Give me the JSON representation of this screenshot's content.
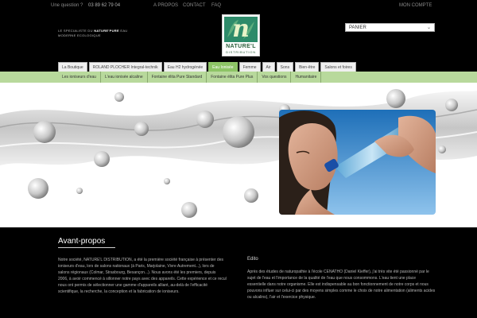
{
  "topbar": {
    "question": "Une question ?",
    "phone": "03 89 62 79 04",
    "links": [
      "A PROPOS",
      "CONTACT",
      "FAQ"
    ],
    "account": "MON COMPTE"
  },
  "header": {
    "tagline_line1_prefix": "LE SPECIALISTE DU",
    "tagline_brand": "NATURE'PURE",
    "tagline_line1_suffix": "EAU",
    "tagline_line2": "MODERNE ECOLOGIQUE",
    "logo_word": "NATURE'L",
    "logo_sub": "DISTRIBUTION",
    "logo_letter": "n",
    "cart_label": "PANIER"
  },
  "nav": {
    "main": [
      "La Boutique",
      "ROLAND PLOCHER Integral-technik",
      "Eau H2 hydrogénée",
      "Eau Ionisée",
      "Femme",
      "Air",
      "Sons",
      "Bien-être",
      "Salons et foires"
    ],
    "active_main": 3,
    "sub": [
      "Les ioniseurs d'eau",
      "L'eau ionisée alcaline",
      "Fontaine élita Pure Standard",
      "Fontaine élita Pure Plus",
      "Vos questions",
      "Humanitaire"
    ]
  },
  "content": {
    "title": "Avant-propos",
    "left_text": "Notre société, NATURE'L DISTRIBUTION, a été la première société française à présenter des ioniseurs d'eau, lors de salons nationaux (à Paris, Marjolaine, Vivre Autrement...), lors de salons régionaux (Colmar, Strasbourg, Besançon...). Nous avons été les premiers, depuis 2006, à avoir commencé à sillonner notre pays avec des appareils. Cette expérience et ce recul nous ont permis de sélectionner une gamme d'appareils alliant, au-delà de l'efficacité scientifique, la recherche, la conception et la fabrication de ioniseurs.",
    "edito_title": "Edito",
    "right_text": "Après des études de naturopathie à l'école CENATHO (Daniel Kieffer), j'ai très vite été passionné par le sujet de l'eau et l'importance de la qualité de l'eau que nous consommons. L'eau tient une place essentielle dans notre organisme. Elle est indispensable au bon fonctionnement de notre corps et nous pouvons influer sur celui-ci par des moyens simples comme le choix de notre alimentation (aliments acides ou alcalins), l'air et l'exercice physique."
  },
  "colors": {
    "background": "#000000",
    "nav_active": "#8dc466",
    "subnav": "#b8d99c",
    "logo_green": "#2e8b6a"
  }
}
